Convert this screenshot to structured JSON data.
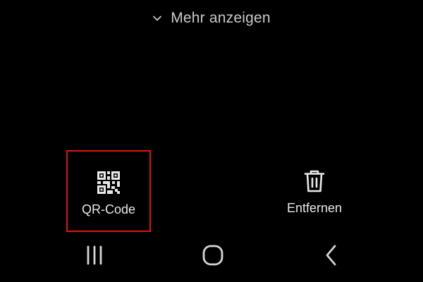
{
  "show_more": {
    "label": "Mehr anzeigen",
    "icon": "chevron-down-icon"
  },
  "actions": [
    {
      "label": "QR-Code",
      "icon": "qr-code-icon",
      "highlighted": true
    },
    {
      "label": "Entfernen",
      "icon": "trash-icon",
      "highlighted": false
    }
  ],
  "navbar": {
    "recents_icon": "recent-apps-icon",
    "home_icon": "home-icon",
    "back_icon": "back-icon"
  },
  "colors": {
    "background": "#000000",
    "text": "#e8e8e8",
    "secondary_text": "#c9c9c9",
    "highlight_border": "#e41212"
  }
}
